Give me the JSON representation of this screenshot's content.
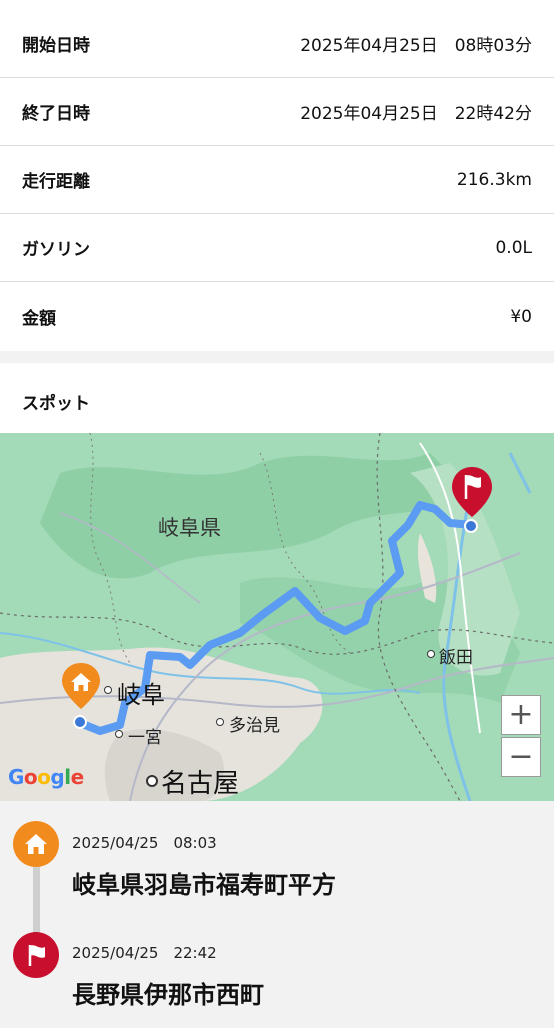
{
  "info_rows": [
    {
      "label": "開始日時",
      "value": "2025年04月25日　08時03分"
    },
    {
      "label": "終了日時",
      "value": "2025年04月25日　22時42分"
    },
    {
      "label": "走行距離",
      "value": "216.3km"
    },
    {
      "label": "ガソリン",
      "value": "0.0L"
    },
    {
      "label": "金額",
      "value": "¥0"
    }
  ],
  "spot_section": {
    "title": "スポット"
  },
  "map": {
    "labels": {
      "gifu_pref": "岐阜県",
      "gifu": "岐阜",
      "ichinomiya": "一宮",
      "tajimi": "多治見",
      "nagoya": "名古屋",
      "iida": "飯田"
    },
    "attribution": "Google",
    "zoom_in": "+",
    "zoom_out": "−",
    "route_color": "#5b9bf2",
    "start_marker_color": "#f28b1e",
    "end_marker_color": "#c8102e"
  },
  "timeline": [
    {
      "date": "2025/04/25　08:03",
      "address": "岐阜県羽島市福寿町平方",
      "icon": "home-icon"
    },
    {
      "date": "2025/04/25　22:42",
      "address": "長野県伊那市西町",
      "icon": "flag-icon"
    }
  ]
}
